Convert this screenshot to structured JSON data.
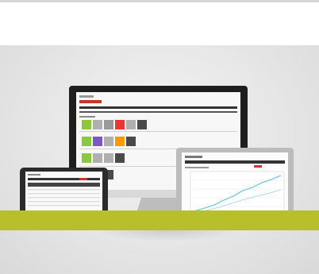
{
  "scene": {
    "subject": "responsive-devices-mockup",
    "accent_color": "#b7bf2a",
    "background_color": "#ececec"
  },
  "devices": {
    "monitor": {
      "tile_colors": [
        "#8dc63f",
        "#b0b0b0",
        "#9a9a9a",
        "#e53935",
        "#b0b0b0",
        "#4a4a4a",
        "#8dc63f",
        "#7e57c2",
        "#b0b0b0",
        "#ff9800",
        "#4a4a4a",
        "#8dc63f",
        "#b0b0b0",
        "#b0b0b0",
        "#4a4a4a",
        "#8dc63f",
        "#b0b0b0",
        "#4a4a4a"
      ]
    },
    "laptop": {
      "line_color": "#7ec8e3"
    },
    "tablet": {
      "header_color": "#333333"
    }
  }
}
